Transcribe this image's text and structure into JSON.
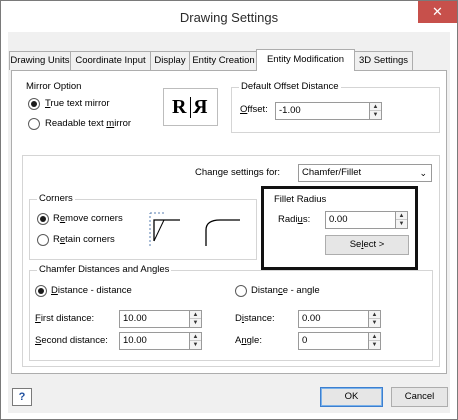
{
  "window": {
    "title": "Drawing Settings",
    "close_glyph": "✕"
  },
  "tabs": [
    {
      "label": "Drawing Units"
    },
    {
      "label": "Coordinate Input"
    },
    {
      "label": "Display"
    },
    {
      "label": "Entity Creation"
    },
    {
      "label": "Entity Modification"
    },
    {
      "label": "3D Settings"
    }
  ],
  "active_tab": "Entity Modification",
  "mirror": {
    "group_label": "Mirror Option",
    "true_text_pre": "T",
    "true_text_post": "rue text mirror",
    "readable_pre": "Readable text ",
    "readable_ul": "m",
    "readable_post": "irror",
    "selected": "true_text_mirror",
    "preview_left": "R",
    "preview_right": "R"
  },
  "offset": {
    "group_label": "Default Offset Distance",
    "label_ul": "O",
    "label_post": "ffset:",
    "value": "-1.00"
  },
  "change_settings": {
    "label_pre": "Chan",
    "label_ul": "g",
    "label_post": "e settings for:",
    "value": "Chamfer/Fillet"
  },
  "corners": {
    "group_label": "Corners",
    "remove_pre": "R",
    "remove_ul": "e",
    "remove_post": "move corners",
    "retain_pre": "R",
    "retain_ul": "e",
    "retain_post": "tain corners",
    "selected": "remove_corners"
  },
  "fillet": {
    "group_label": "Fillet Radius",
    "radius_pre": "Radi",
    "radius_ul": "u",
    "radius_post": "s:",
    "radius_value": "0.00",
    "select_pre": "Se",
    "select_ul": "l",
    "select_post": "ect >"
  },
  "chamfer": {
    "group_label": "Chamfer Distances and Angles",
    "dd_pre": "",
    "dd_ul": "D",
    "dd_post": "istance - distance",
    "da_pre": "Distan",
    "da_ul": "c",
    "da_post": "e - angle",
    "selected": "distance_distance",
    "first_ul": "F",
    "first_post": "irst distance:",
    "first_value": "10.00",
    "second_ul": "S",
    "second_post": "econd distance:",
    "second_value": "10.00",
    "dist_pre": "D",
    "dist_ul": "i",
    "dist_post": "stance:",
    "dist_value": "0.00",
    "angle_pre": "A",
    "angle_ul": "n",
    "angle_post": "gle:",
    "angle_value": "0"
  },
  "footer": {
    "help_glyph": "?",
    "ok_label": "OK",
    "cancel_label": "Cancel"
  }
}
